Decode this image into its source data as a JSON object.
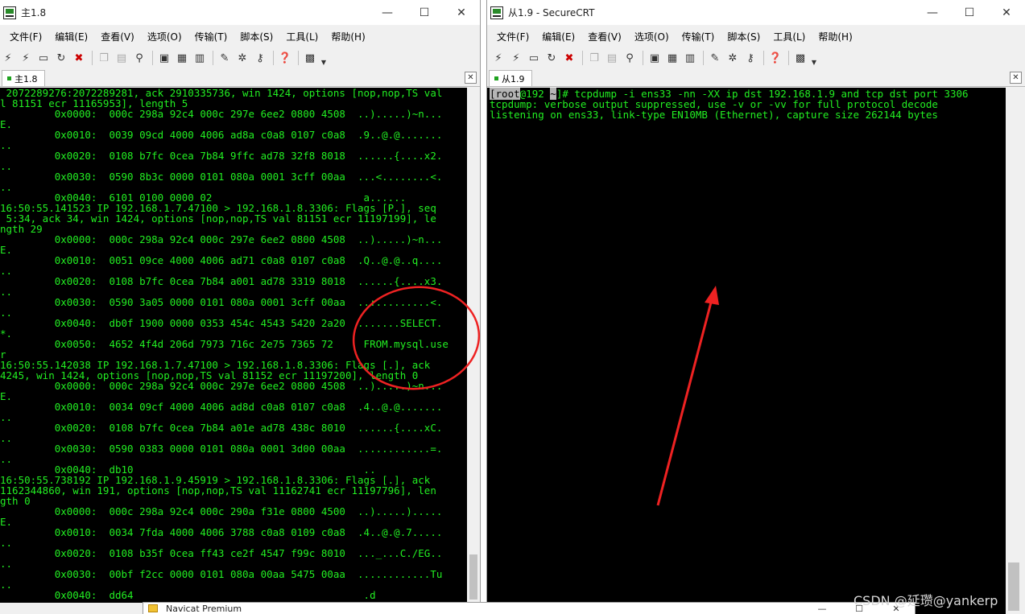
{
  "left_window": {
    "title": "主1.8",
    "menu": [
      "文件(F)",
      "编辑(E)",
      "查看(V)",
      "选项(O)",
      "传输(T)",
      "脚本(S)",
      "工具(L)",
      "帮助(H)"
    ],
    "tab_label": "主1.8",
    "terminal_lines": [
      " 2072289276:2072289281, ack 2910335736, win 1424, options [nop,nop,TS val",
      "l 81151 ecr 11165953], length 5",
      "         0x0000:  000c 298a 92c4 000c 297e 6ee2 0800 4508  ..).....)~n...",
      "E.",
      "         0x0010:  0039 09cd 4000 4006 ad8a c0a8 0107 c0a8  .9..@.@.......",
      "..",
      "         0x0020:  0108 b7fc 0cea 7b84 9ffc ad78 32f8 8018  ......{....x2.",
      "..",
      "         0x0030:  0590 8b3c 0000 0101 080a 0001 3cff 00aa  ...<........<.",
      "..",
      "         0x0040:  6101 0100 0000 02                         a......",
      "16:50:55.141523 IP 192.168.1.7.47100 > 192.168.1.8.3306: Flags [P.], seq",
      " 5:34, ack 34, win 1424, options [nop,nop,TS val 81151 ecr 11197199], le",
      "ngth 29",
      "         0x0000:  000c 298a 92c4 000c 297e 6ee2 0800 4508  ..).....)~n...",
      "E.",
      "         0x0010:  0051 09ce 4000 4006 ad71 c0a8 0107 c0a8  .Q..@.@..q....",
      "..",
      "         0x0020:  0108 b7fc 0cea 7b84 a001 ad78 3319 8018  ......{....x3.",
      "..",
      "         0x0030:  0590 3a05 0000 0101 080a 0001 3cff 00aa  ..:.........<.",
      "..",
      "         0x0040:  db0f 1900 0000 0353 454c 4543 5420 2a20  .......SELECT.",
      "*.",
      "         0x0050:  4652 4f4d 206d 7973 716c 2e75 7365 72     FROM.mysql.use",
      "r",
      "16:50:55.142038 IP 192.168.1.7.47100 > 192.168.1.8.3306: Flags [.], ack",
      "4245, win 1424, options [nop,nop,TS val 81152 ecr 11197200], length 0",
      "         0x0000:  000c 298a 92c4 000c 297e 6ee2 0800 4508  ..).....)~n...",
      "E.",
      "         0x0010:  0034 09cf 4000 4006 ad8d c0a8 0107 c0a8  .4..@.@.......",
      "..",
      "         0x0020:  0108 b7fc 0cea 7b84 a01e ad78 438c 8010  ......{....xC.",
      "..",
      "         0x0030:  0590 0383 0000 0101 080a 0001 3d00 00aa  ............=.",
      "..",
      "         0x0040:  db10                                      ..",
      "16:50:55.738192 IP 192.168.1.9.45919 > 192.168.1.8.3306: Flags [.], ack",
      "1162344860, win 191, options [nop,nop,TS val 11162741 ecr 11197796], len",
      "gth 0",
      "         0x0000:  000c 298a 92c4 000c 290a f31e 0800 4500  ..).....).....",
      "E.",
      "         0x0010:  0034 7fda 4000 4006 3788 c0a8 0109 c0a8  .4..@.@.7.....",
      "..",
      "         0x0020:  0108 b35f 0cea ff43 ce2f 4547 f99c 8010  ..._...C./EG..",
      "..",
      "         0x0030:  00bf f2cc 0000 0101 080a 00aa 5475 00aa  ............Tu",
      "..",
      "         0x0040:  dd64                                      .d"
    ]
  },
  "right_window": {
    "title": "从1.9 - SecureCRT",
    "menu": [
      "文件(F)",
      "编辑(E)",
      "查看(V)",
      "选项(O)",
      "传输(T)",
      "脚本(S)",
      "工具(L)",
      "帮助(H)"
    ],
    "tab_label": "从1.9",
    "prompt_user": "root",
    "prompt_host": "@192 ",
    "prompt_dir": "~",
    "command": "]# tcpdump -i ens33 -nn -XX ip dst 192.168.1.9 and tcp dst port 3306",
    "output_lines": [
      "tcpdump: verbose output suppressed, use -v or -vv for full protocol decode",
      "listening on ens33, link-type EN10MB (Ethernet), capture size 262144 bytes"
    ]
  },
  "toolbar_icons": [
    "connect-icon",
    "quick-connect-icon",
    "connect-tab-icon",
    "reconnect-icon",
    "disconnect-icon",
    "copy-icon",
    "paste-icon",
    "find-icon",
    "print-icon",
    "print-setup-icon",
    "print-screen-icon",
    "session-options-icon",
    "global-options-icon",
    "keymap-icon",
    "help-icon",
    "sftp-icon"
  ],
  "window_controls": {
    "minimize": "—",
    "maximize": "☐",
    "close": "✕"
  },
  "watermark": "CSDN @延瓒@yankerp",
  "bottom_window": {
    "title": "Navicat Premium"
  },
  "colors": {
    "terminal_bg": "#000000",
    "terminal_fg": "#22ee22",
    "annotation": "#ee2222"
  }
}
